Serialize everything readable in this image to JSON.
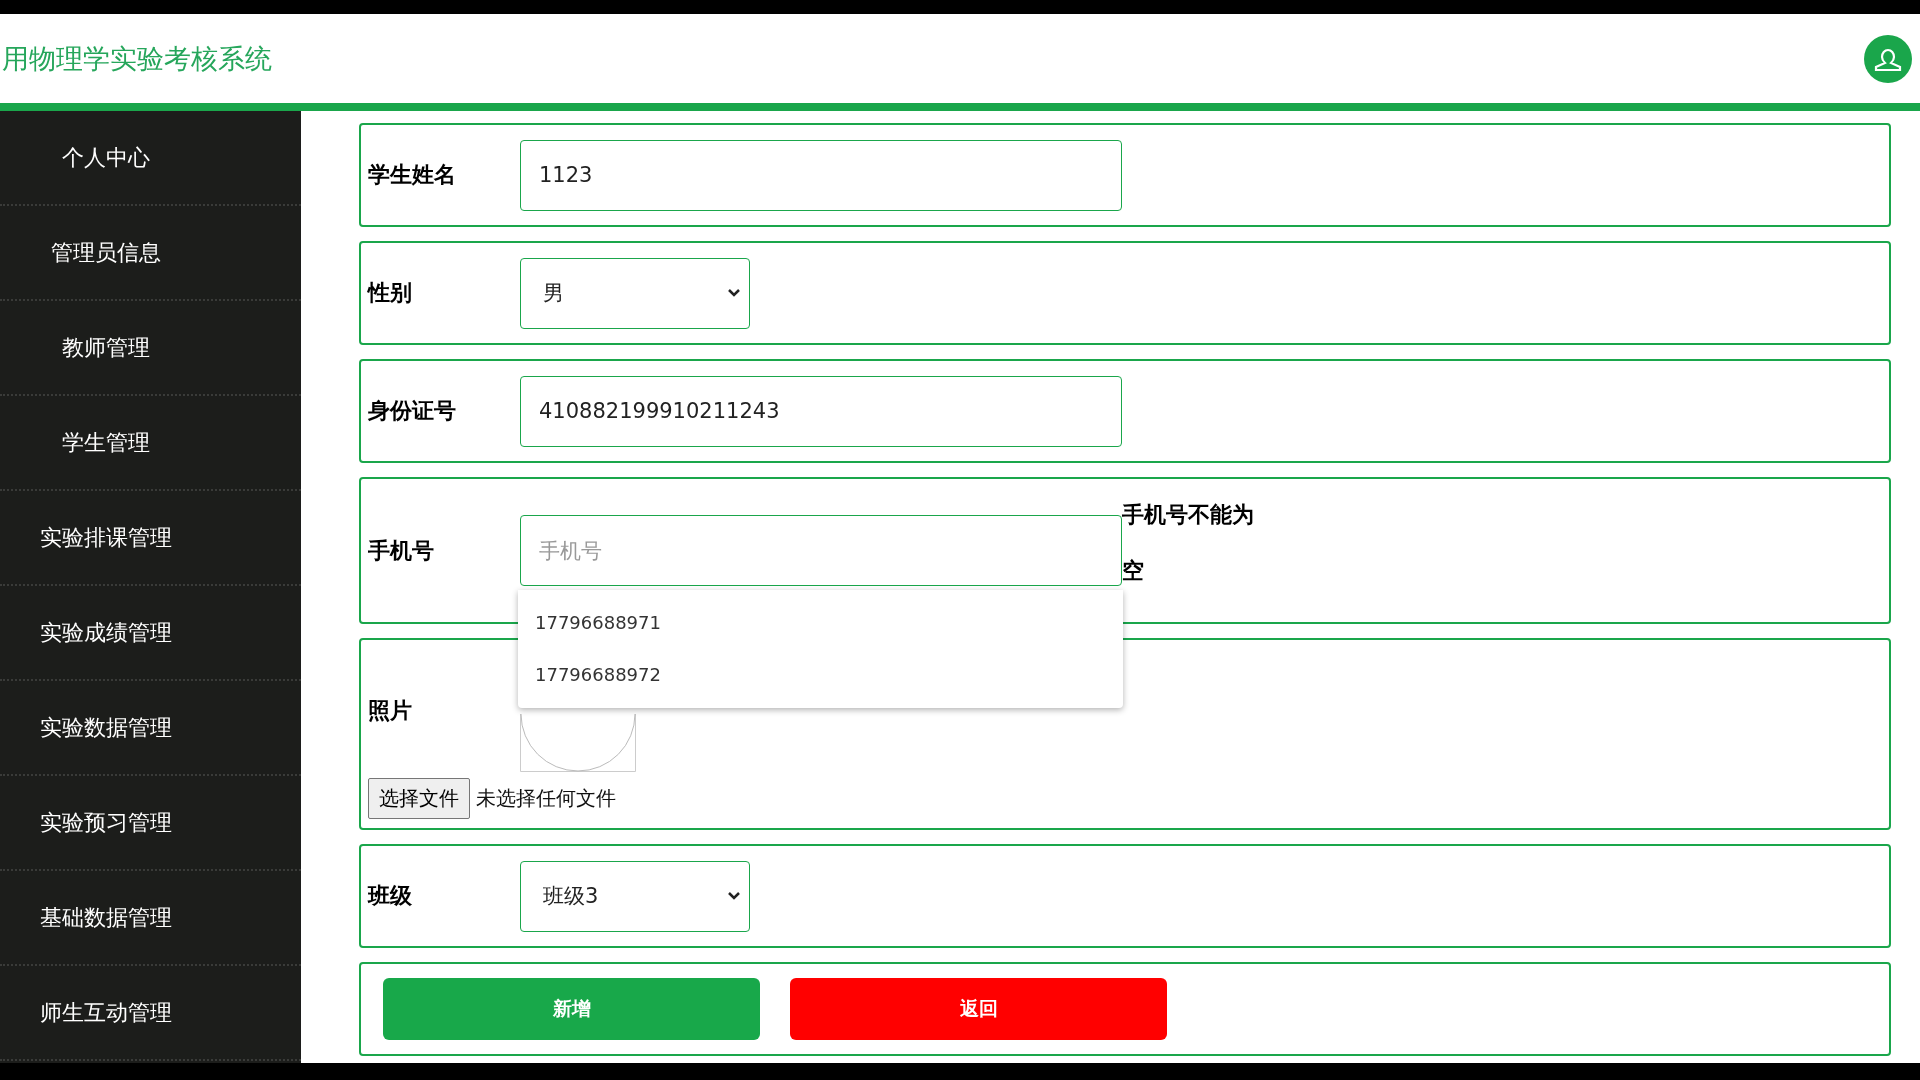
{
  "header": {
    "title": "用物理学实验考核系统"
  },
  "sidebar": {
    "items": [
      {
        "label": "个人中心"
      },
      {
        "label": "管理员信息"
      },
      {
        "label": "教师管理"
      },
      {
        "label": "学生管理"
      },
      {
        "label": "实验排课管理"
      },
      {
        "label": "实验成绩管理"
      },
      {
        "label": "实验数据管理"
      },
      {
        "label": "实验预习管理"
      },
      {
        "label": "基础数据管理"
      },
      {
        "label": "师生互动管理"
      }
    ]
  },
  "form": {
    "fields": [
      {
        "kind": "text",
        "label": "学生姓名",
        "value": "1123"
      },
      {
        "kind": "select",
        "label": "性别",
        "value": "男"
      },
      {
        "kind": "text",
        "label": "身份证号",
        "value": "410882199910211243"
      },
      {
        "kind": "text",
        "label": "手机号",
        "placeholder": "手机号",
        "error": "手机号不能为空",
        "suggestions": [
          "17796688971",
          "17796688972"
        ]
      },
      {
        "kind": "file",
        "label": "照片",
        "button": "选择文件",
        "status": "未选择任何文件"
      },
      {
        "kind": "select",
        "label": "班级",
        "value": "班级3"
      }
    ],
    "buttons": [
      {
        "kind": "primary",
        "label": "新增"
      },
      {
        "kind": "danger",
        "label": "返回"
      }
    ]
  }
}
